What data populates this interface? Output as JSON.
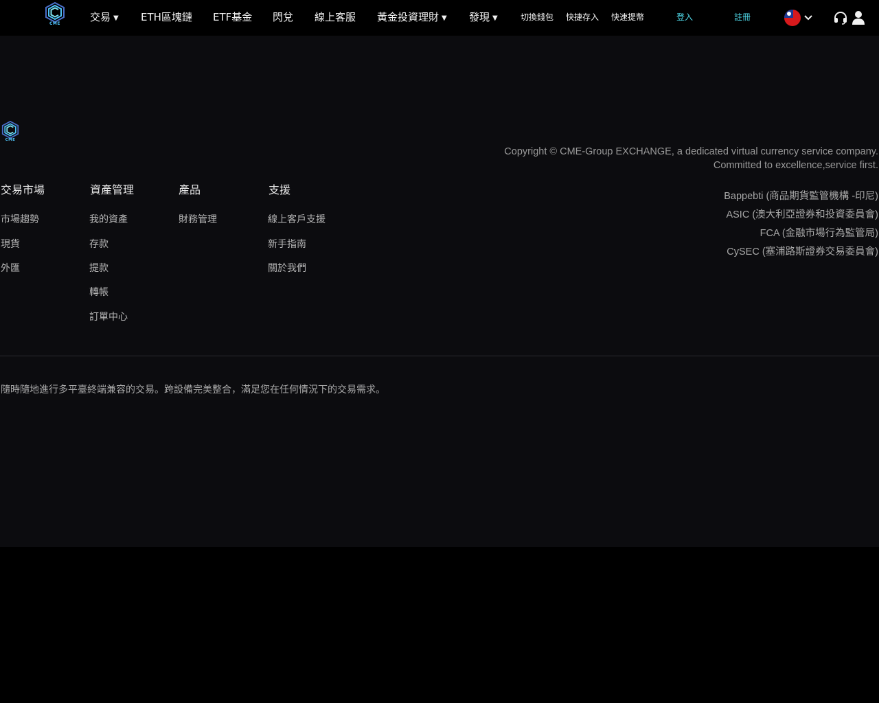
{
  "brand": {
    "logo_text": "CME",
    "accent_color": "#4fd8e8"
  },
  "nav": {
    "items": [
      {
        "label": "交易",
        "has_caret": true
      },
      {
        "label": "ETH區塊鏈",
        "has_caret": false
      },
      {
        "label": "ETF基金",
        "has_caret": false
      },
      {
        "label": "閃兌",
        "has_caret": false
      },
      {
        "label": "線上客服",
        "has_caret": false
      },
      {
        "label": "黃金投資理財",
        "has_caret": true
      },
      {
        "label": "發現",
        "has_caret": true
      }
    ],
    "caret": "▼",
    "quick_links": [
      "切換錢包",
      "快捷存入",
      "快速提幣"
    ],
    "login": "登入",
    "register": "註冊",
    "language_icon": "taiwan-flag-icon",
    "support_icon": "headset-icon",
    "account_icon": "user-icon"
  },
  "footer": {
    "logo_text": "CME",
    "columns": [
      {
        "title": "交易市場",
        "links": [
          "市場趨勢",
          "現貨",
          "外匯"
        ]
      },
      {
        "title": "資產管理",
        "links": [
          "我的資產",
          "存款",
          "提款",
          "轉帳",
          "訂單中心"
        ]
      },
      {
        "title": "產品",
        "links": [
          "財務管理"
        ]
      },
      {
        "title": "支援",
        "links": [
          "線上客戶支援",
          "新手指南",
          "關於我們"
        ]
      }
    ],
    "copyright_line1": "Copyright © CME-Group EXCHANGE, a dedicated virtual currency service company.",
    "copyright_line2": "Committed to excellence,service first.",
    "regulators": [
      "Bappebti (商品期貨監管機構 -印尼)",
      "ASIC (澳大利亞證券和投資委員會)",
      "FCA (金融市場行為監管局)",
      "CySEC (塞浦路斯證券交易委員會)"
    ],
    "tagline": "隨時隨地進行多平臺終端兼容的交易。跨設備完美整合，滿足您在任何情況下的交易需求。"
  }
}
